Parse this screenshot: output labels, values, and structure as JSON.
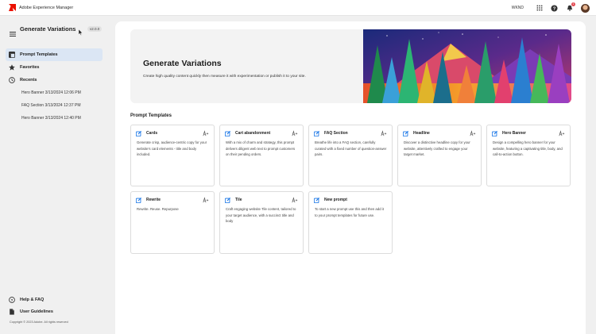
{
  "topbar": {
    "app_title": "Adobe Experience Manager",
    "org": "WKND",
    "notification_count": "1",
    "icons": [
      "adobe-logo",
      "apps-grid-icon",
      "help-icon",
      "bell-icon",
      "avatar"
    ]
  },
  "sidebar": {
    "title": "Generate Variations",
    "version": "v2.0.0",
    "nav": {
      "prompt_templates": "Prompt Templates",
      "favorites": "Favorites",
      "recents": "Recents"
    },
    "recents": [
      "Hero Banner 3/13/2024 12:06 PM",
      "FAQ Section 3/13/2024 12:37 PM",
      "Hero Banner 3/13/2024 12:40 PM"
    ],
    "footer": {
      "help": "Help & FAQ",
      "guidelines": "User Guidelines",
      "copyright": "Copyright © 2023 Adobe. All rights reserved"
    }
  },
  "hero": {
    "title": "Generate Variations",
    "description": "Create high quality content quickly then measure it with experimentation or publish it to your site."
  },
  "section_title": "Prompt Templates",
  "cards": [
    {
      "title": "Cards",
      "description": "Generate crisp, audience-centric copy for your website's card elements - title and body included."
    },
    {
      "title": "Cart abandonment",
      "description": "With a mix of charm and strategy, this prompt delivers diligent web text to prompt customers on their pending orders."
    },
    {
      "title": "FAQ Section",
      "description": "Breathe life into a FAQ section, carefully curated with a fixed number of question-answer pairs."
    },
    {
      "title": "Headline",
      "description": "Discover a distinctive headline copy for your website, attentively crafted to engage your target market."
    },
    {
      "title": "Hero Banner",
      "description": "Design a compelling hero banner for your website, featuring a captivating title, body, and call-to-action button."
    },
    {
      "title": "Rewrite",
      "description": "Rewrite. Reuse. Repurpose"
    },
    {
      "title": "Tile",
      "description": "Craft engaging website Tile content, tailored to your target audience, with a succinct title and body"
    },
    {
      "title": "New prompt",
      "description": "To start a new prompt use this and then add it to your prompt templates for future use."
    }
  ],
  "colors": {
    "accent": "#1473e6",
    "active_nav_bg": "#dbe6f4",
    "adobe_red": "#eb1000"
  }
}
